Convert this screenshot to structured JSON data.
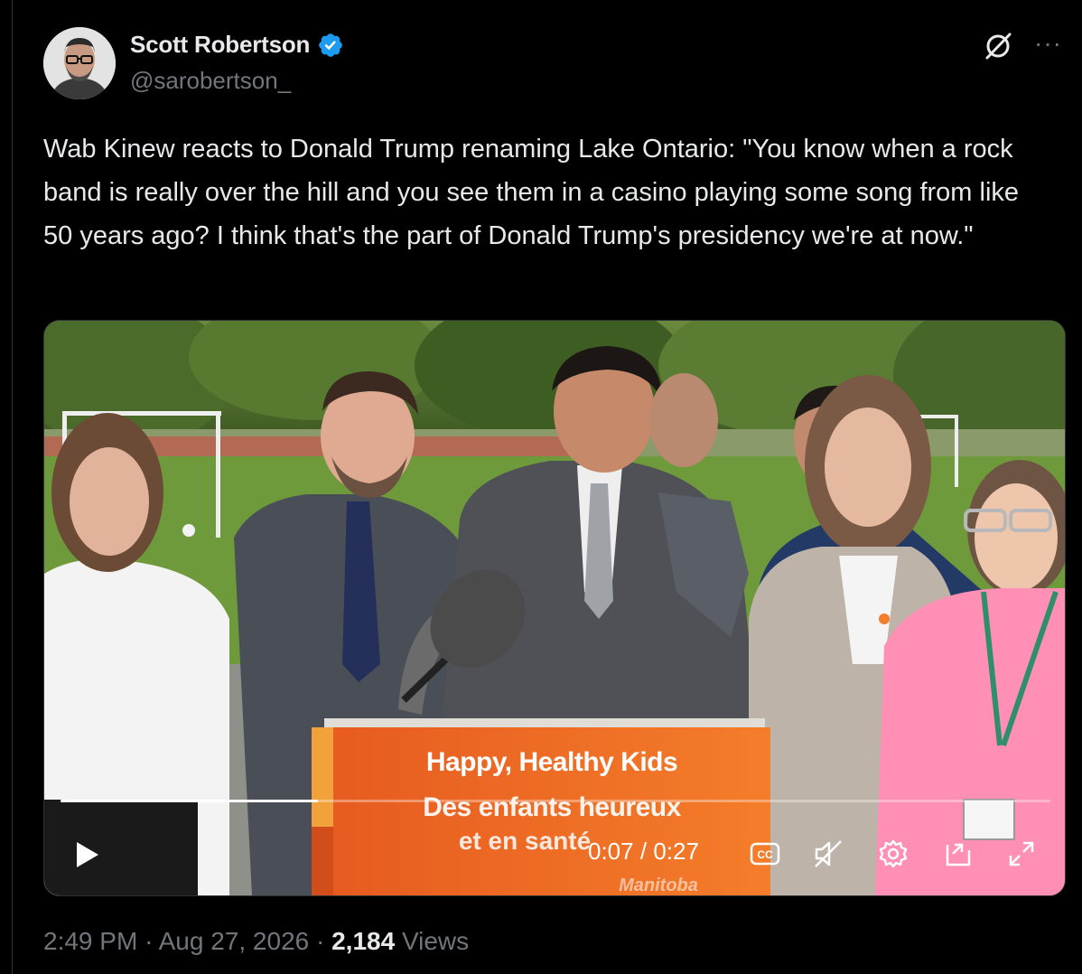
{
  "author": {
    "display_name": "Scott Robertson",
    "handle": "@sarobertson_",
    "verified": true,
    "avatar_icon": "profile-photo"
  },
  "tweet": {
    "text": "Wab Kinew reacts to Donald Trump renaming Lake Ontario: \"You know when a rock band is really over the hill and you see them in a casino playing some song from like 50 years ago? I think that's the part of Donald Trump's presidency we're at now.\""
  },
  "video": {
    "podium_line1": "Happy, Healthy Kids",
    "podium_line2": "Des enfants heureux",
    "podium_line3": "et en santé",
    "podium_logo": "Manitoba",
    "current_time": "0:07",
    "time_separator": "/",
    "duration": "0:27",
    "progress": 0.26,
    "cc_label": "CC"
  },
  "meta": {
    "time": "2:49 PM",
    "separator": "·",
    "date": "Aug 27, 2026",
    "views_count": "2,184",
    "views_label": "Views"
  },
  "colors": {
    "accent_verified": "#1d9bf0",
    "text_primary": "#e7e9ea",
    "text_secondary": "#71767b",
    "background": "#000000"
  }
}
